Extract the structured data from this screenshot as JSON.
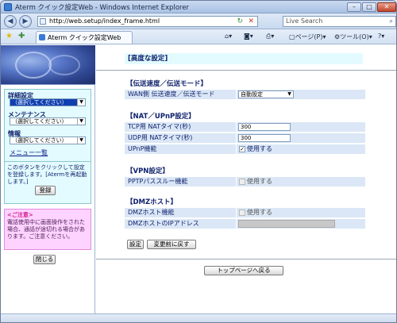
{
  "window": {
    "title": "Aterm クイック設定Web - Windows Internet Explorer"
  },
  "address_bar": {
    "url": "http://web.setup/index_frame.html",
    "search_placeholder": "Live Search"
  },
  "tab": {
    "label": "Aterm クイック設定Web"
  },
  "commands": {
    "page_label": "ページ(P)",
    "tools_label": "ツール(O)"
  },
  "sidebar": {
    "sections": [
      {
        "label": "詳細設定",
        "select_value": "（選択してください）"
      },
      {
        "label": "メンテナンス",
        "select_value": "（選択してください）"
      },
      {
        "label": "情報",
        "select_value": "（選択してください）"
      }
    ],
    "menu_link": "メニュー一覧",
    "register_text": "このボタンをクリックして設定を登録します。[Atermを再起動します。]",
    "register_button": "登録",
    "warning_title": "<ご注意>",
    "warning_text": "電話使用中に画面操作をされた場合、通話が途切れる場合があります。ご注意ください。",
    "close_button": "閉じる"
  },
  "main": {
    "page_title": "[高度な設定]",
    "sections": {
      "speed": {
        "heading": "【伝送速度／伝送モード】",
        "wan_label": "WAN側 伝送速度／伝送モード",
        "wan_value": "自動設定"
      },
      "nat": {
        "heading": "【NAT／UPnP設定】",
        "tcp_label": "TCP用 NATタイマ(秒)",
        "tcp_value": "300",
        "udp_label": "UDP用 NATタイマ(秒)",
        "udp_value": "300",
        "upnp_label": "UPnP機能",
        "upnp_check_label": "使用する",
        "upnp_checked": true
      },
      "vpn": {
        "heading": "【VPN設定】",
        "pptp_label": "PPTPパススルー機能",
        "pptp_check_label": "使用する",
        "pptp_checked": false
      },
      "dmz": {
        "heading": "【DMZホスト】",
        "dmz_label": "DMZホスト機能",
        "dmz_check_label": "使用する",
        "dmz_checked": false,
        "ip_label": "DMZホストのIPアドレス",
        "ip_value": ""
      }
    },
    "apply_button": "設定",
    "revert_button": "変更前に戻す",
    "top_button": "トップページへ戻る"
  }
}
